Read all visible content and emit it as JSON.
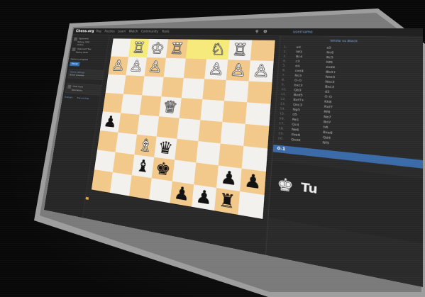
{
  "topbar": {
    "logo": "Chess.org",
    "nav": [
      "Play",
      "Puzzles",
      "Learn",
      "Watch",
      "Community",
      "Tools"
    ],
    "icons": [
      "search-icon",
      "gear-icon"
    ],
    "user_label": "username"
  },
  "sidebar": {
    "player_lines": [
      "Opponent",
      "Rating 1500",
      "Online"
    ],
    "player2_lines": [
      "Opponent Two",
      "Rating 1400"
    ],
    "info_text": "Game in progress",
    "button_label": "Resign",
    "link_lines": [
      "Game settings",
      "Board preview"
    ],
    "chat_lines": [
      "Chat room",
      "Spectators"
    ],
    "footer_links": [
      "Analysis",
      "Export PGN"
    ]
  },
  "board": {
    "light_color": "#f3f1ee",
    "dark_color": "#f2c98a",
    "highlight_color": "#f6ea7a",
    "highlight": [
      "b1",
      "e1",
      "f1"
    ],
    "squares": [
      [
        " ",
        "wR",
        "wK",
        "wR",
        " ",
        "wN",
        "wR",
        " "
      ],
      [
        "wP",
        "wP",
        "wP",
        " ",
        " ",
        "wP",
        "wP",
        "wP"
      ],
      [
        " ",
        " ",
        " ",
        " ",
        " ",
        " ",
        " ",
        " "
      ],
      [
        " ",
        " ",
        " ",
        "wQ",
        " ",
        " ",
        " ",
        " "
      ],
      [
        "bP",
        " ",
        " ",
        " ",
        " ",
        " ",
        " ",
        " "
      ],
      [
        " ",
        " ",
        "wB",
        "bQ",
        " ",
        " ",
        " ",
        " "
      ],
      [
        " ",
        " ",
        " ",
        " ",
        " ",
        " ",
        "bP",
        " "
      ],
      [
        " ",
        " ",
        " ",
        " ",
        "bP",
        "bP",
        " ",
        " "
      ]
    ],
    "lower_pieces": [
      [
        " ",
        " ",
        "bB",
        "bK",
        " ",
        " ",
        "bB",
        "bP"
      ],
      [
        " ",
        " ",
        " ",
        " ",
        " ",
        " ",
        "bR",
        " "
      ]
    ]
  },
  "movelist": {
    "header": "White vs Black",
    "moves": [
      [
        "1.",
        "e4",
        "e5"
      ],
      [
        "2.",
        "Nf3",
        "Nc6"
      ],
      [
        "3.",
        "Bc4",
        "Bc5"
      ],
      [
        "4.",
        "c3",
        "Nf6"
      ],
      [
        "5.",
        "d4",
        "exd4"
      ],
      [
        "6.",
        "cxd4",
        "Bb4+"
      ],
      [
        "7.",
        "Nc3",
        "Nxe4"
      ],
      [
        "8.",
        "O-O",
        "Nxc3"
      ],
      [
        "9.",
        "bxc3",
        "Bxc3"
      ],
      [
        "10.",
        "Qb3",
        "d5"
      ],
      [
        "11.",
        "Bxd5",
        "O-O"
      ],
      [
        "12.",
        "Bxf7+",
        "Kh8"
      ],
      [
        "13.",
        "Qxc3",
        "Rxf7"
      ],
      [
        "14.",
        "Ng5",
        "Rf6"
      ],
      [
        "15.",
        "d5",
        "Ne7"
      ],
      [
        "16.",
        "Re1",
        "Bd7"
      ],
      [
        "17.",
        "Qc4",
        "h6"
      ],
      [
        "18.",
        "Ne6",
        "Bxe6"
      ],
      [
        "19.",
        "dxe6",
        "Qd4"
      ],
      [
        "20.",
        "Qxd4",
        "Nf5"
      ]
    ],
    "result": "0-1",
    "turn_label": "Tu"
  }
}
